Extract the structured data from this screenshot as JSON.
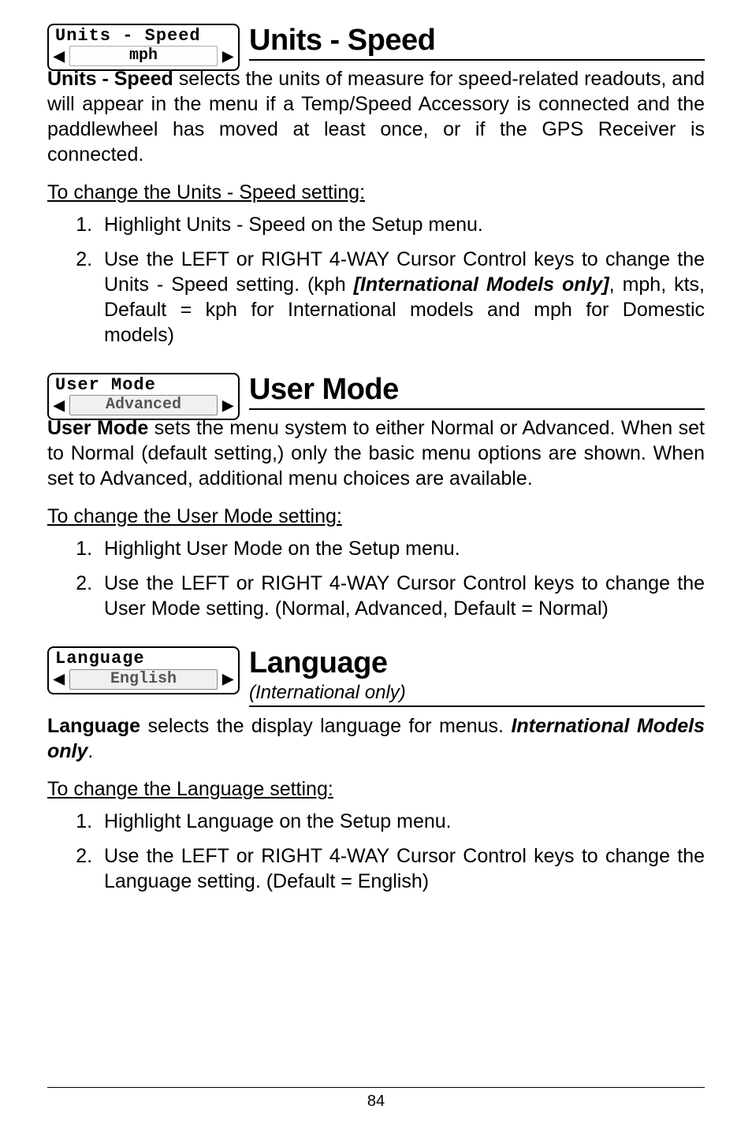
{
  "page_number": "84",
  "sections": {
    "speed": {
      "menu_label": "Units - Speed",
      "menu_value": "mph",
      "title": "Units - Speed",
      "lead_bold": "Units - Speed",
      "lead_rest": " selects the units of measure for speed-related readouts, and will appear in the menu if a Temp/Speed Accessory is connected and the paddlewheel has moved at least once, or if the GPS Receiver is connected.",
      "subheading": "To change the Units - Speed setting:",
      "steps": [
        "Highlight Units - Speed on the Setup menu.",
        {
          "pre": "Use the LEFT or RIGHT 4-WAY Cursor Control keys to change the Units - Speed setting. (kph ",
          "ital": "[International Models only]",
          "post": ", mph, kts, Default = kph for International models and mph for Domestic models)"
        }
      ]
    },
    "usermode": {
      "menu_label": "User Mode",
      "menu_value": "Advanced",
      "title": "User Mode",
      "lead_bold": "User Mode",
      "lead_rest": " sets the menu system to either Normal or Advanced. When set to Normal (default setting,) only the basic menu options are shown.  When set to Advanced, additional menu choices are available.",
      "subheading": "To change the User Mode setting:",
      "steps": [
        "Highlight User Mode on the Setup menu.",
        "Use the LEFT or RIGHT 4-WAY Cursor Control keys to change the User Mode setting. (Normal, Advanced, Default = Normal)"
      ]
    },
    "language": {
      "menu_label": "Language",
      "menu_value": "English",
      "title": "Language",
      "subtitle": "(International only)",
      "body_bold": "Language",
      "body_mid": " selects the display language for menus. ",
      "body_ital": "International Models only",
      "body_end": ".",
      "subheading": "To change the Language setting:",
      "steps": [
        "Highlight Language on the Setup menu.",
        "Use the LEFT or RIGHT 4-WAY Cursor Control keys to change the Language setting. (Default = English)"
      ]
    }
  }
}
